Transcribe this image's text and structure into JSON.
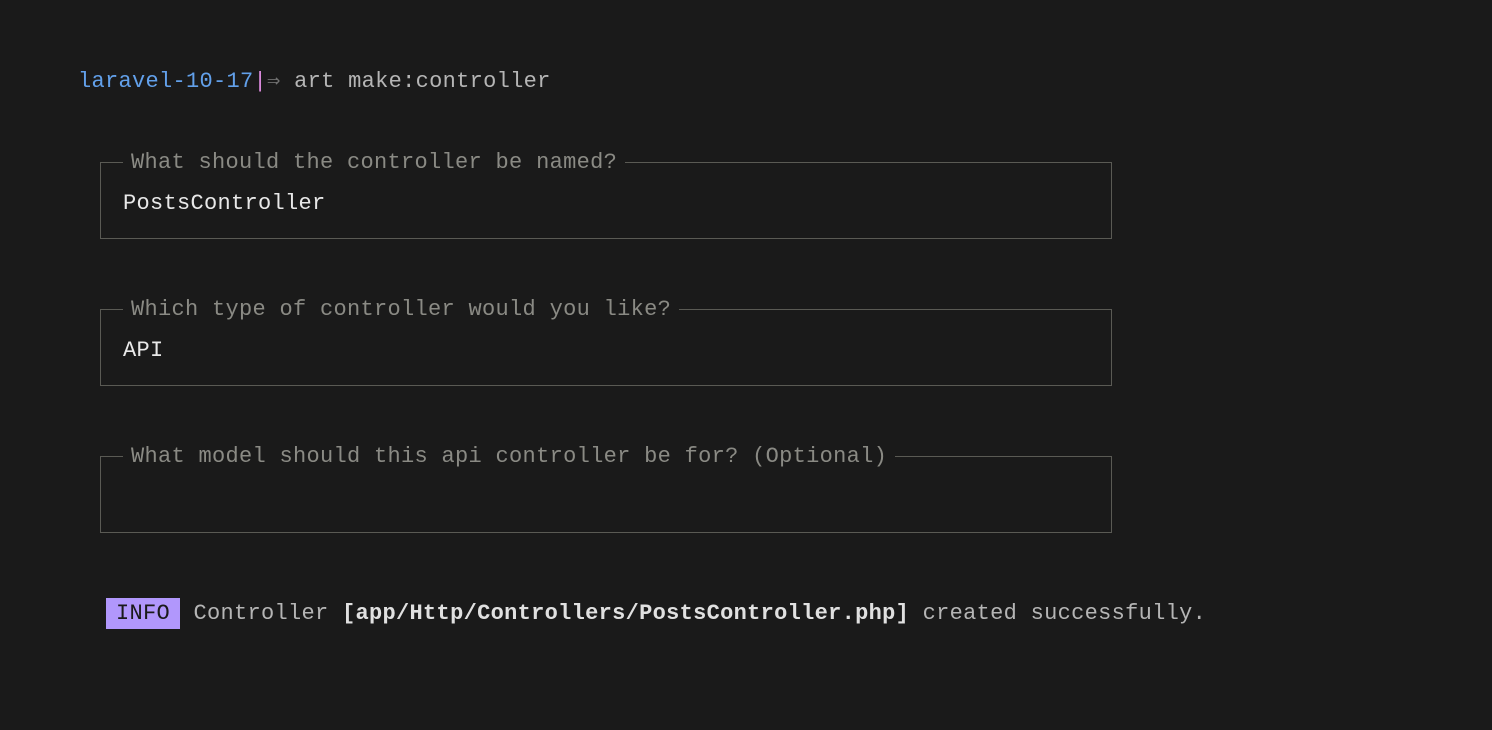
{
  "prompt": {
    "path": "laravel-10-17",
    "separator": "|",
    "arrow": "⇒",
    "command": "art make:controller"
  },
  "fields": [
    {
      "label": " What should the controller be named? ",
      "value": "PostsController"
    },
    {
      "label": " Which type of controller would you like? ",
      "value": "API"
    },
    {
      "label": " What model should this api controller be for? (Optional) ",
      "value": ""
    }
  ],
  "info": {
    "badge": "INFO",
    "prefix": "  Controller ",
    "path": "[app/Http/Controllers/PostsController.php]",
    "suffix": " created successfully."
  }
}
